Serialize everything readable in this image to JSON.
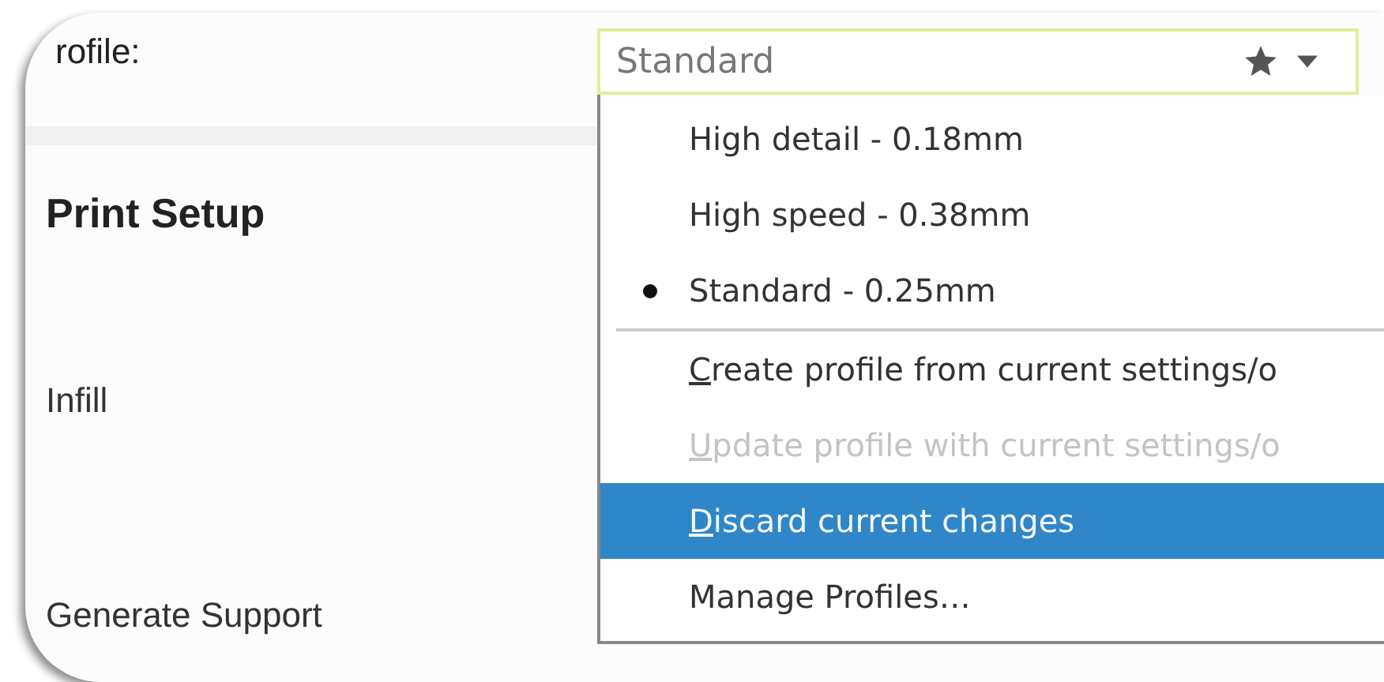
{
  "left_panel": {
    "profile_label": "rofile:",
    "section_title": "Print Setup",
    "settings": [
      {
        "label": "Infill"
      },
      {
        "label": "Generate Support"
      }
    ]
  },
  "profile_combo": {
    "value": "Standard",
    "favorite": true
  },
  "menu": [
    {
      "kind": "profile",
      "label": "High detail - 0.18mm",
      "selected": false
    },
    {
      "kind": "profile",
      "label": "High speed - 0.38mm",
      "selected": false
    },
    {
      "kind": "profile",
      "label": "Standard - 0.25mm",
      "selected": true
    },
    {
      "kind": "separator"
    },
    {
      "kind": "action",
      "label": "Create profile from current settings/o",
      "mnemonic": true,
      "disabled": false,
      "highlighted": false
    },
    {
      "kind": "action",
      "label": "Update profile with current settings/o",
      "mnemonic": true,
      "disabled": true,
      "highlighted": false
    },
    {
      "kind": "action",
      "label": "Discard current changes",
      "mnemonic": true,
      "disabled": false,
      "highlighted": true
    },
    {
      "kind": "action",
      "label": "Manage Profiles…",
      "mnemonic": false,
      "disabled": false,
      "highlighted": false
    }
  ]
}
